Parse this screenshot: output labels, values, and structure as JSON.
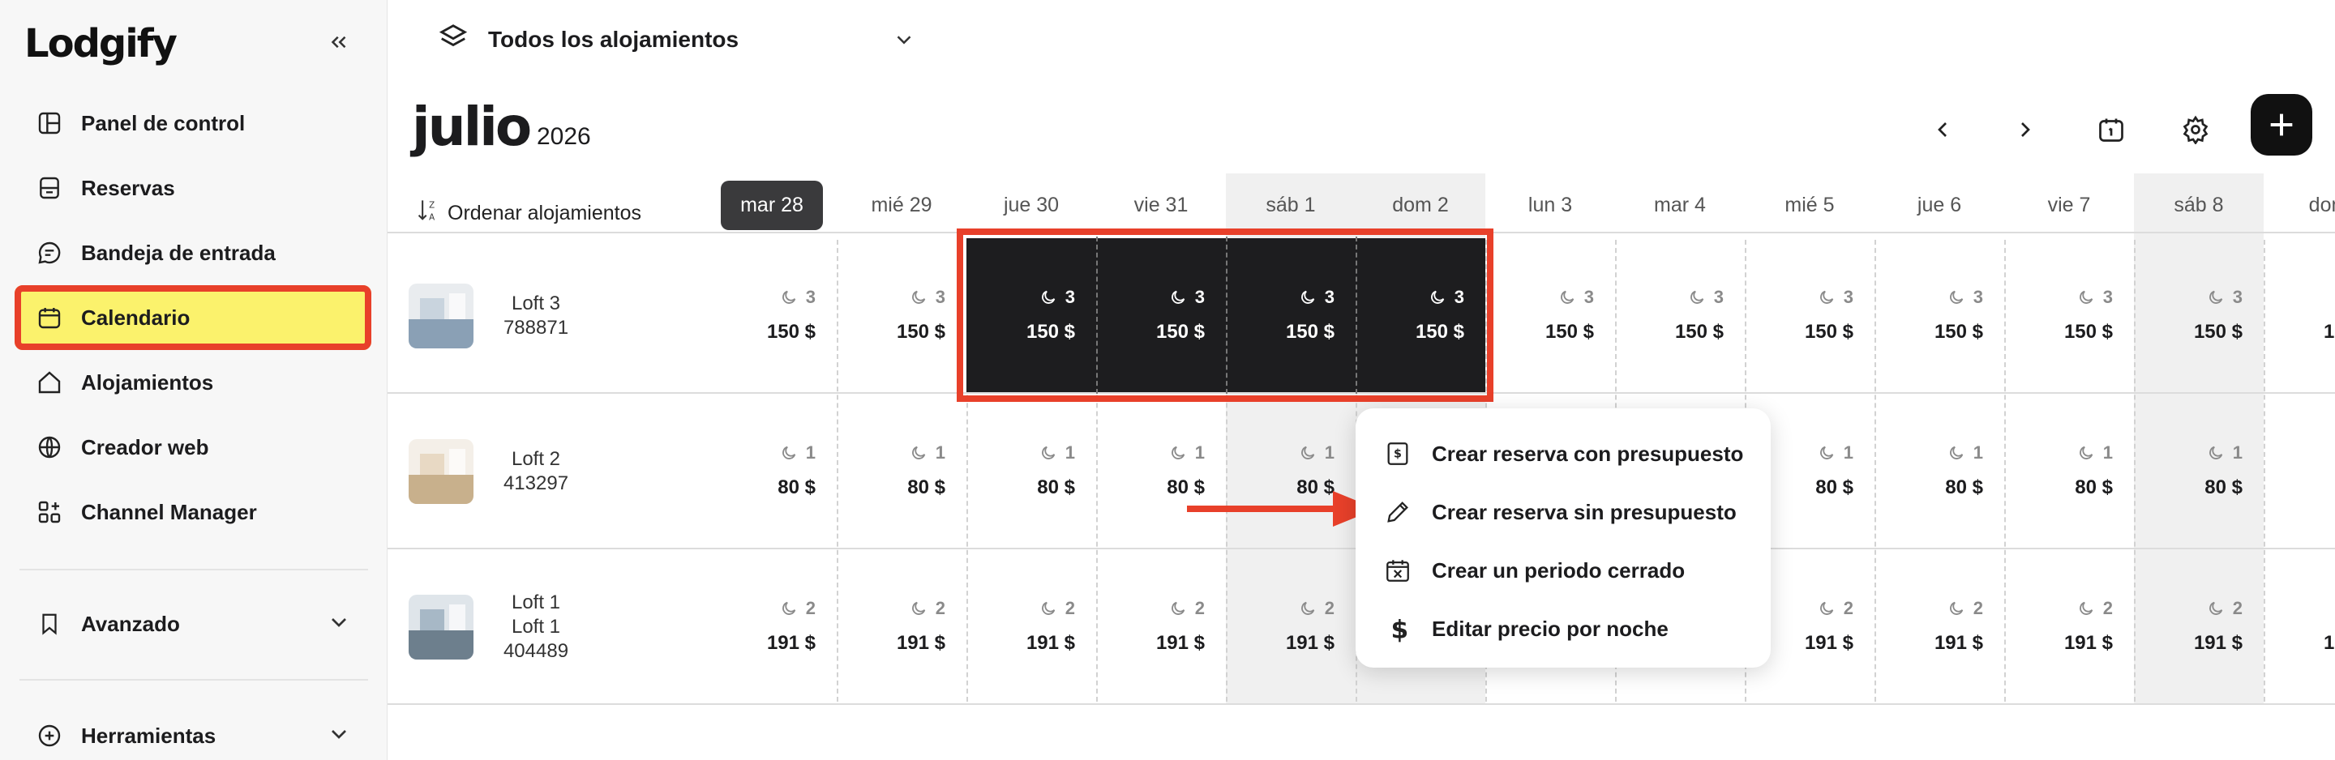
{
  "brand": {
    "logo": "Lodgify"
  },
  "sidebar": {
    "items": [
      {
        "label": "Panel de control",
        "icon": "layout-icon"
      },
      {
        "label": "Reservas",
        "icon": "bookings-icon"
      },
      {
        "label": "Bandeja de entrada",
        "icon": "chat-icon"
      },
      {
        "label": "Calendario",
        "icon": "calendar-icon",
        "active": true
      },
      {
        "label": "Alojamientos",
        "icon": "home-icon"
      },
      {
        "label": "Creador web",
        "icon": "globe-icon"
      },
      {
        "label": "Channel Manager",
        "icon": "apps-icon"
      }
    ],
    "advanced": "Avanzado",
    "tools": "Herramientas"
  },
  "header": {
    "property_select": "Todos los alojamientos",
    "month": "julio",
    "year": "2026"
  },
  "calendar": {
    "sort_label": "Ordenar alojamientos",
    "days": [
      "mar 28",
      "mié 29",
      "jue 30",
      "vie 31",
      "sáb 1",
      "dom 2",
      "lun 3",
      "mar 4",
      "mié 5",
      "jue 6",
      "vie 7",
      "sáb 8",
      "dom"
    ],
    "properties": [
      {
        "name": "Loft 3",
        "sub": "",
        "id": "788871",
        "min_nights": "3",
        "price": "150 $"
      },
      {
        "name": "Loft 2",
        "sub": "",
        "id": "413297",
        "min_nights": "1",
        "price": "80 $"
      },
      {
        "name": "Loft 1",
        "sub": "Loft 1",
        "id": "404489",
        "min_nights": "2",
        "price": "191 $"
      }
    ]
  },
  "context_menu": {
    "items": [
      {
        "label": "Crear reserva con presupuesto",
        "icon": "quote-icon"
      },
      {
        "label": "Crear reserva sin presupuesto",
        "icon": "pencil-icon"
      },
      {
        "label": "Crear un periodo cerrado",
        "icon": "calendar-x-icon"
      },
      {
        "label": "Editar precio por noche",
        "icon": "dollar-icon"
      }
    ]
  },
  "colors": {
    "accent": "#fbf26c",
    "highlight": "#e8402a",
    "selected": "#1d1d1f"
  }
}
